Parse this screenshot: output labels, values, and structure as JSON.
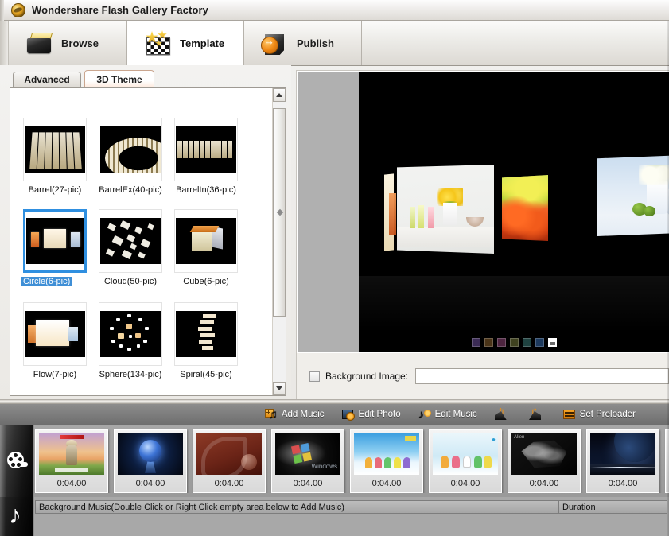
{
  "window": {
    "title": "Wondershare Flash Gallery Factory",
    "app_icon": "globe-icon"
  },
  "topnav": {
    "tabs": [
      {
        "label": "Browse",
        "icon": "folder-icon",
        "active": false
      },
      {
        "label": "Template",
        "icon": "film-star-icon",
        "active": true
      },
      {
        "label": "Publish",
        "icon": "publish-arrow-icon",
        "active": false
      }
    ]
  },
  "left_panel": {
    "tabs": [
      {
        "label": "Advanced",
        "active": false
      },
      {
        "label": "3D Theme",
        "active": true
      }
    ],
    "themes": [
      {
        "label": "Barrel(27-pic)",
        "selected": false
      },
      {
        "label": "BarrelEx(40-pic)",
        "selected": false
      },
      {
        "label": "BarrelIn(36-pic)",
        "selected": false
      },
      {
        "label": "Circle(6-pic)",
        "selected": true
      },
      {
        "label": "Cloud(50-pic)",
        "selected": false
      },
      {
        "label": "Cube(6-pic)",
        "selected": false
      },
      {
        "label": "Flow(7-pic)",
        "selected": false
      },
      {
        "label": "Sphere(134-pic)",
        "selected": false
      },
      {
        "label": "Spiral(45-pic)",
        "selected": false
      }
    ],
    "scrollbar": {
      "up_icon": "scroll-up-arrow-icon",
      "down_icon": "scroll-down-arrow-icon"
    }
  },
  "preview": {
    "swatches": [
      "#3b2b55",
      "#4a3418",
      "#4e2540",
      "#3f4220",
      "#1f4240",
      "#1d3a5e"
    ],
    "current_swatch": "#ffffff",
    "selected_colors_label": "theme-color-swatches"
  },
  "background_image": {
    "checkbox_label": "Background Image:",
    "checked": false,
    "value": "",
    "placeholder": ""
  },
  "media_toolbar": {
    "buttons": [
      {
        "label": "Add Music",
        "icon": "add-music-icon"
      },
      {
        "label": "Edit Photo",
        "icon": "edit-photo-icon"
      },
      {
        "label": "Edit Music",
        "icon": "edit-music-icon"
      },
      {
        "label": "",
        "icon": "rotate-left-icon"
      },
      {
        "label": "",
        "icon": "rotate-right-icon"
      },
      {
        "label": "Set Preloader",
        "icon": "set-preloader-icon"
      }
    ]
  },
  "filmstrip": {
    "reel_icon": "film-reel-icon",
    "frames": [
      {
        "duration": "0:04.00",
        "art": "art1"
      },
      {
        "duration": "0:04.00",
        "art": "art2"
      },
      {
        "duration": "0:04.00",
        "art": "art3"
      },
      {
        "duration": "0:04.00",
        "art": "art4"
      },
      {
        "duration": "0:04.00",
        "art": "art5"
      },
      {
        "duration": "0:04.00",
        "art": "art6"
      },
      {
        "duration": "0:04.00",
        "art": "art7"
      },
      {
        "duration": "0:04.00",
        "art": "art8"
      },
      {
        "duration": "",
        "art": "art9"
      }
    ]
  },
  "music_pane": {
    "note_icon": "music-note-icon",
    "columns": [
      "Background Music(Double Click or Right Click empty area below to Add Music)",
      "Duration"
    ],
    "rows": []
  }
}
